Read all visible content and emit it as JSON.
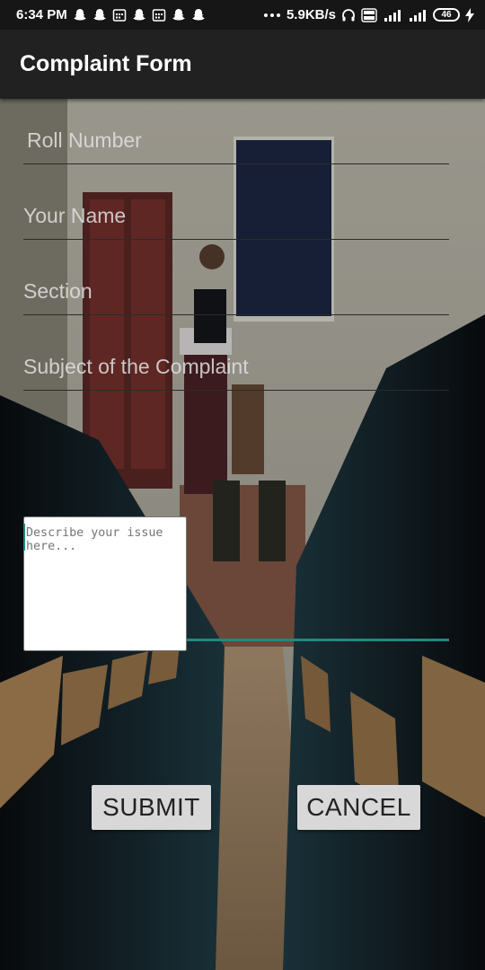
{
  "status_bar": {
    "time": "6:34 PM",
    "network_speed": "5.9KB/s",
    "battery": "46",
    "icons": [
      "snapchat-icon",
      "snapchat-icon",
      "calendar-icon",
      "snapchat-icon",
      "calendar-icon",
      "snapchat-icon",
      "snapchat-icon",
      "more-icon",
      "headphones-icon",
      "volte-icon",
      "signal-4g-icon",
      "signal-icon",
      "battery-icon",
      "charging-icon"
    ]
  },
  "app_bar": {
    "title": "Complaint Form"
  },
  "form": {
    "roll_number_placeholder": "Roll Number",
    "name_placeholder": "Your Name",
    "section_placeholder": "Section",
    "subject_placeholder": "Subject of the Complaint",
    "issue_placeholder": "Describe your issue here..."
  },
  "buttons": {
    "submit": "SUBMIT",
    "cancel": "CANCEL"
  },
  "colors": {
    "accent": "#1f8a80",
    "app_bar": "#212121",
    "status_bar": "#161616"
  }
}
